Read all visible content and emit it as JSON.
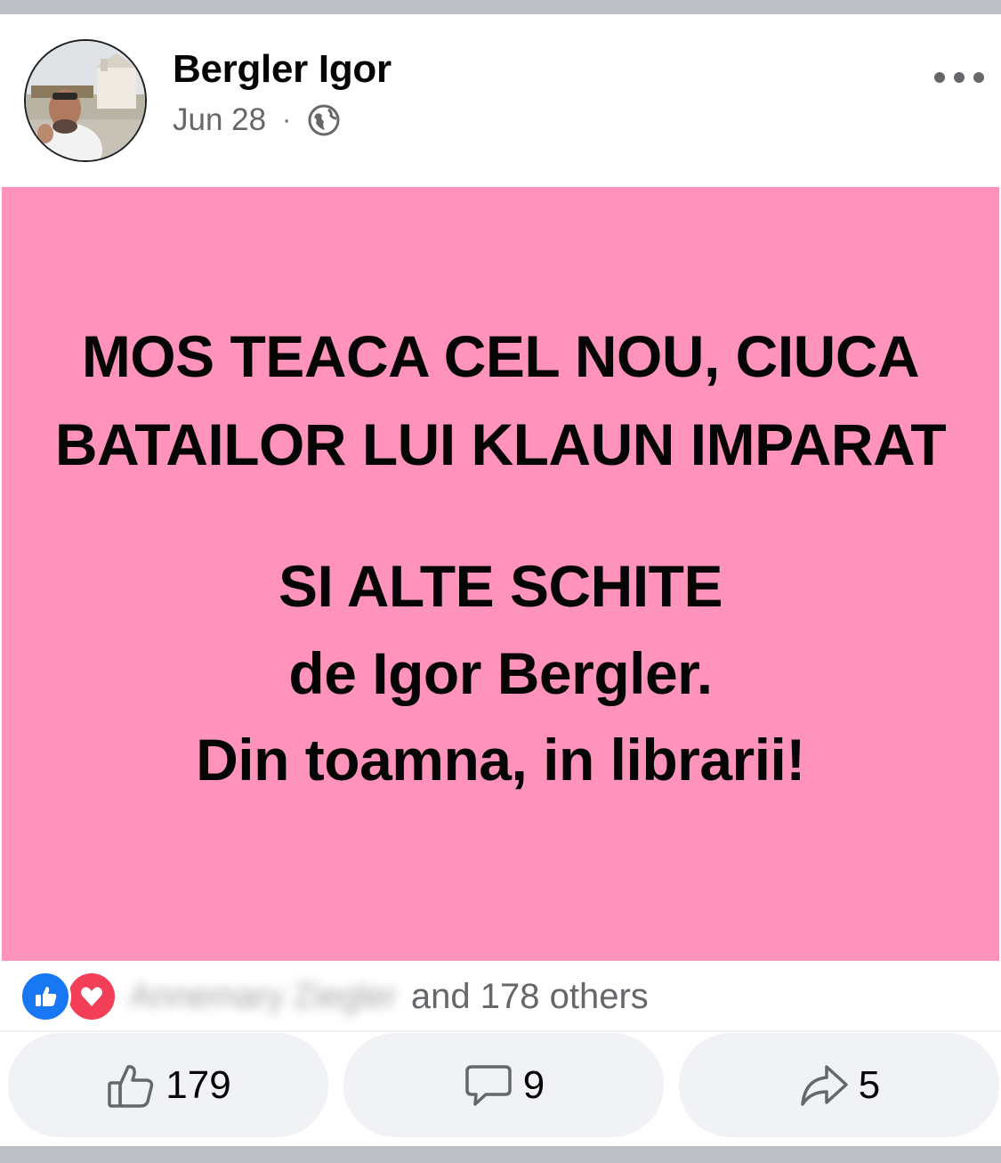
{
  "post": {
    "author": "Bergler Igor",
    "date": "Jun 28",
    "separator": "·",
    "audience_icon": "globe-icon",
    "more_icon": "more-options-icon",
    "background_color": "#ff93bb",
    "text_lines": [
      "MOS TEACA CEL NOU, CIUCA",
      "BATAILOR LUI KLAUN IMPARAT",
      "SI ALTE SCHITE",
      "de Igor Bergler.",
      "Din toamna, in librarii!"
    ]
  },
  "reactions": {
    "icons": [
      "like-reaction-icon",
      "love-reaction-icon"
    ],
    "first_reactor_blurred": "Annemary Ziegler",
    "others_text": "and 178 others"
  },
  "actions": {
    "like": {
      "icon": "thumbs-up-icon",
      "count": "179"
    },
    "comment": {
      "icon": "comment-icon",
      "count": "9"
    },
    "share": {
      "icon": "share-arrow-icon",
      "count": "5"
    }
  },
  "colors": {
    "accent_like": "#1877f2",
    "love": "#f33e58",
    "secondary_text": "#65676b",
    "button_bg": "#f0f2f5"
  }
}
